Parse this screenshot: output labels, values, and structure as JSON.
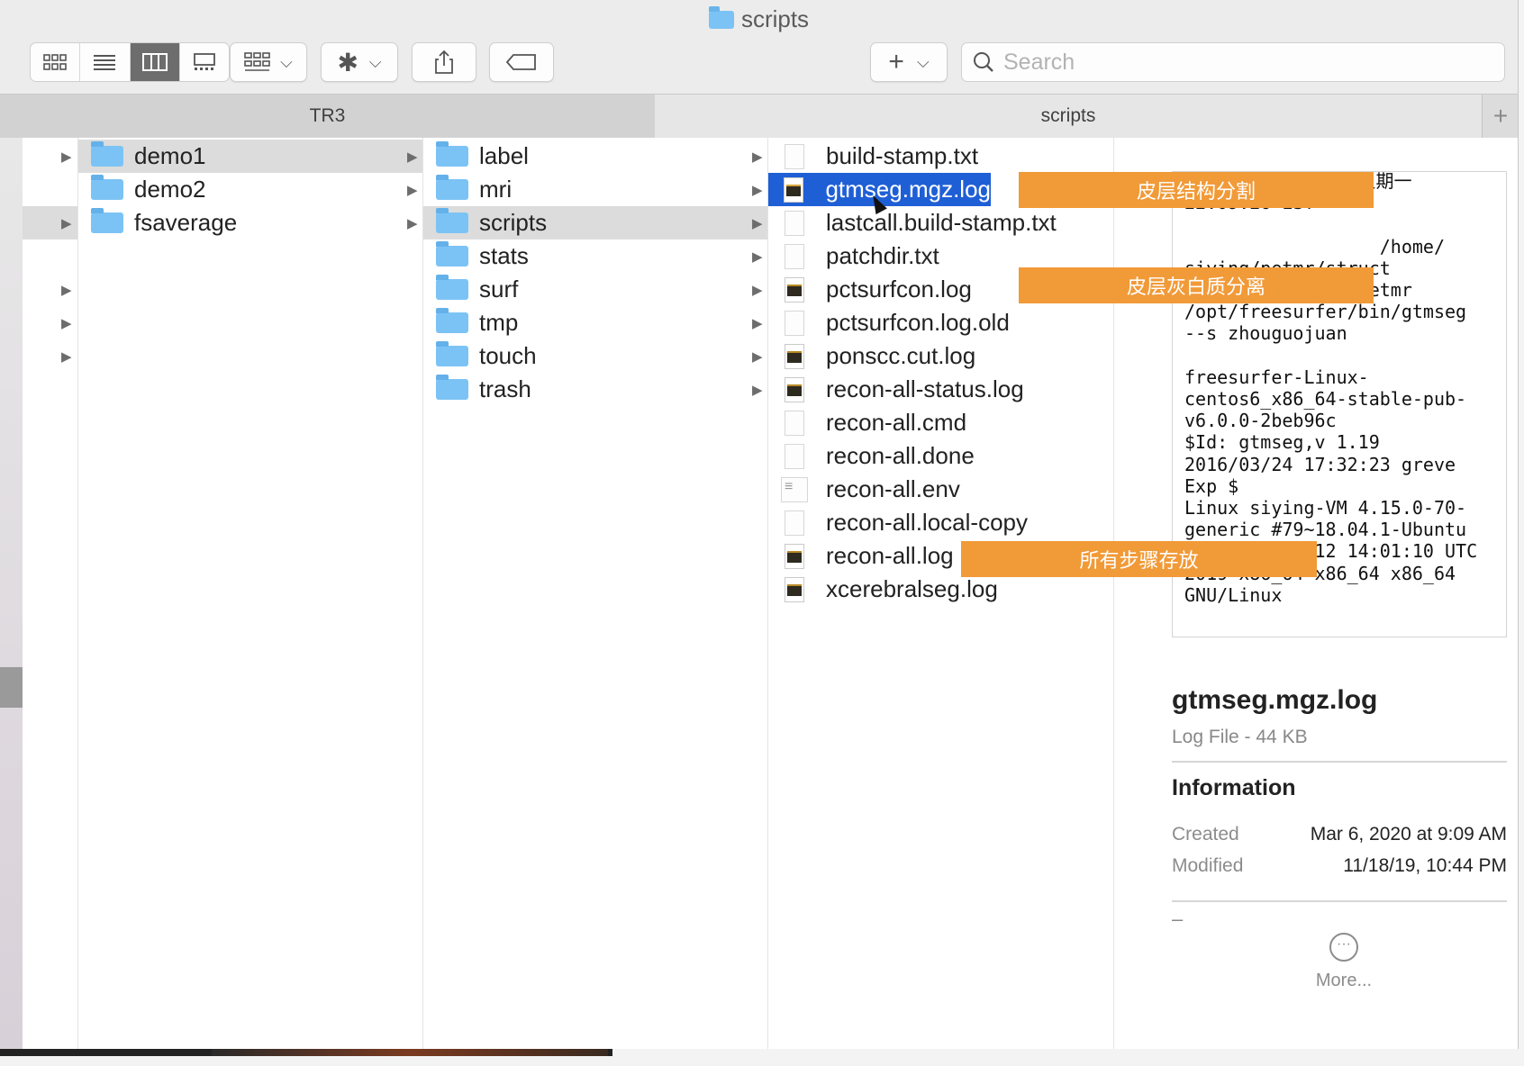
{
  "window": {
    "title": "scripts"
  },
  "toolbar": {
    "view_icons": [
      "icon-view-icon",
      "list-view-icon",
      "column-view-icon",
      "gallery-view-icon"
    ],
    "search_placeholder": "Search"
  },
  "pathbar": {
    "left": "TR3",
    "right": "scripts"
  },
  "column1": {
    "items": [
      "demo1",
      "demo2",
      "fsaverage"
    ]
  },
  "column2": {
    "items": [
      "label",
      "mri",
      "scripts",
      "stats",
      "surf",
      "tmp",
      "touch",
      "trash"
    ]
  },
  "column3": {
    "items": [
      {
        "name": "build-stamp.txt",
        "kind": "txt"
      },
      {
        "name": "gtmseg.mgz.log",
        "kind": "log"
      },
      {
        "name": "lastcall.build-stamp.txt",
        "kind": "txt"
      },
      {
        "name": "patchdir.txt",
        "kind": "txt"
      },
      {
        "name": "pctsurfcon.log",
        "kind": "log"
      },
      {
        "name": "pctsurfcon.log.old",
        "kind": "txt"
      },
      {
        "name": "ponscc.cut.log",
        "kind": "log"
      },
      {
        "name": "recon-all-status.log",
        "kind": "log"
      },
      {
        "name": "recon-all.cmd",
        "kind": "txt"
      },
      {
        "name": "recon-all.done",
        "kind": "txt"
      },
      {
        "name": "recon-all.env",
        "kind": "env"
      },
      {
        "name": "recon-all.local-copy",
        "kind": "txt"
      },
      {
        "name": "recon-all.log",
        "kind": "log"
      },
      {
        "name": "xcerebralseg.log",
        "kind": "log"
      }
    ]
  },
  "preview": {
    "text": "2019年 11月 18日 星期一\n22:09:26 EST\n\n                  /home/\nsiying/petmr/struct\ncd /home/siying/petmr\n/opt/freesurfer/bin/gtmseg\n--s zhouguojuan\n\nfreesurfer-Linux-\ncentos6_x86_64-stable-pub-\nv6.0.0-2beb96c\n$Id: gtmseg,v 1.19\n2016/03/24 17:32:23 greve\nExp $\nLinux siying-VM 4.15.0-70-\ngeneric #79~18.04.1-Ubuntu\nSMP Tue Nov 12 14:01:10 UTC\n2019 x86_64 x86_64 x86_64\nGNU/Linux",
    "filename": "gtmseg.mgz.log",
    "kind": "Log File - 44 KB",
    "info_heading": "Information",
    "created_label": "Created",
    "created_value": "Mar 6, 2020 at 9:09 AM",
    "modified_label": "Modified",
    "modified_value": "11/18/19, 10:44 PM",
    "dash": "–",
    "more_label": "More..."
  },
  "annotations": [
    "皮层结构分割",
    "皮层灰白质分离",
    "所有步骤存放"
  ],
  "colors": {
    "selection": "#1f5fd6",
    "annotation": "#f19a38",
    "folder": "#7cc3f5"
  }
}
